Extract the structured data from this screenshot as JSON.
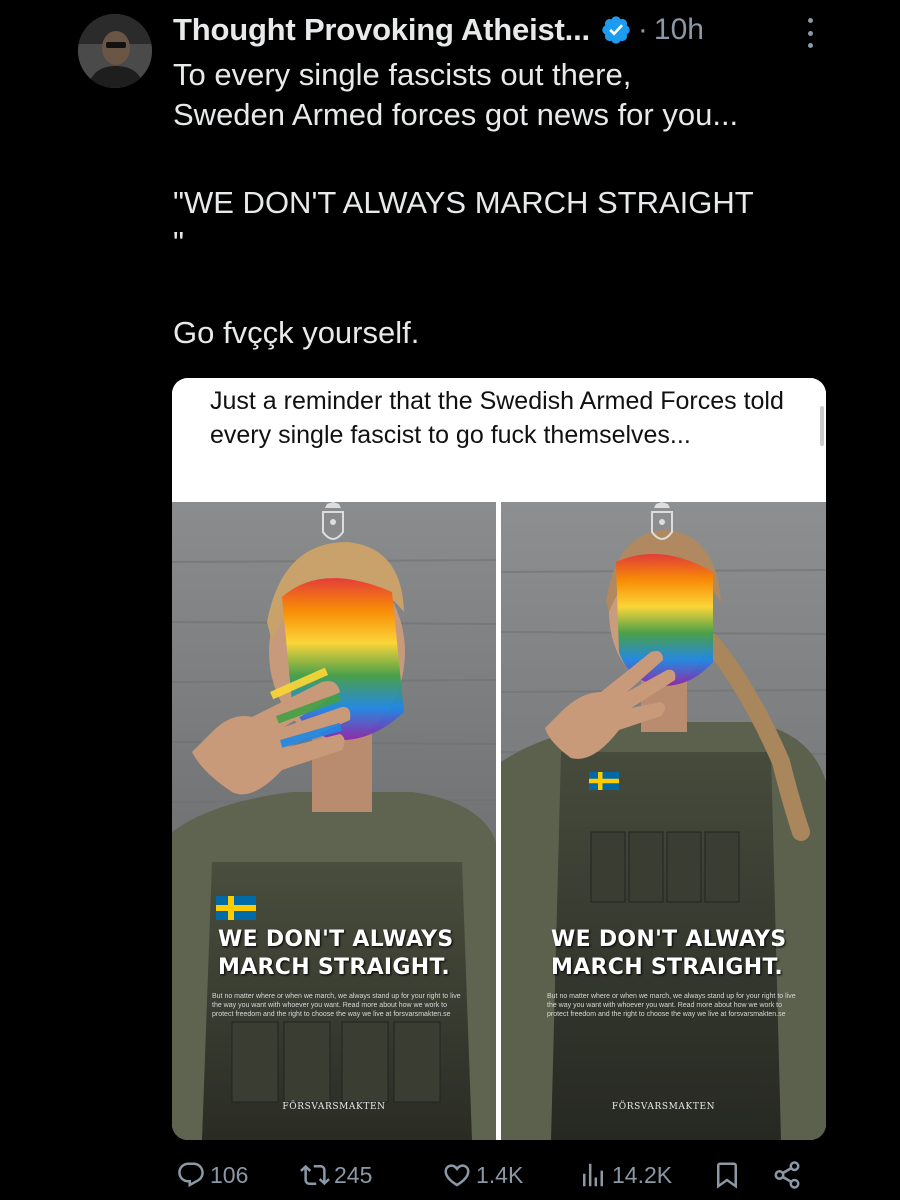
{
  "post": {
    "author_name": "Thought Provoking Atheist...",
    "separator": "·",
    "timestamp": "10h",
    "text_lines": [
      "To every single fascists out there,",
      "Sweden Armed forces got news for you...",
      "",
      "\"WE DON'T ALWAYS MARCH STRAIGHT",
      "\"",
      "",
      "Go fvççk yourself."
    ]
  },
  "quote": {
    "text": "Just a reminder that the Swedish Armed Forces told every single fascist to go fuck themselves..."
  },
  "posters": [
    {
      "headline_line1": "WE DON'T ALWAYS",
      "headline_line2": "MARCH STRAIGHT.",
      "small_print": "But no matter where or when we march, we always stand up for your right to live the way you want with whoever you want. Read more about how we work to protect freedom and the right to choose the way we live at forsvarsmakten.se",
      "logo_text": "FÖRSVARSMAKTEN"
    },
    {
      "headline_line1": "WE DON'T ALWAYS",
      "headline_line2": "MARCH STRAIGHT.",
      "small_print": "But no matter where or when we march, we always stand up for your right to live the way you want with whoever you want. Read more about how we work to protect freedom and the right to choose the way we live at forsvarsmakten.se",
      "logo_text": "FÖRSVARSMAKTEN"
    }
  ],
  "actions": {
    "replies": "106",
    "reposts": "245",
    "likes": "1.4K",
    "views": "14.2K"
  },
  "colors": {
    "background": "#000000",
    "text": "#e7e9ea",
    "muted": "#8b98a5",
    "verified": "#1d9bf0"
  },
  "icons": [
    "avatar",
    "verified-icon",
    "more-icon",
    "reply-icon",
    "repost-icon",
    "like-icon",
    "views-icon",
    "bookmark-icon",
    "share-icon",
    "swedish-flag-icon",
    "crest-icon"
  ]
}
